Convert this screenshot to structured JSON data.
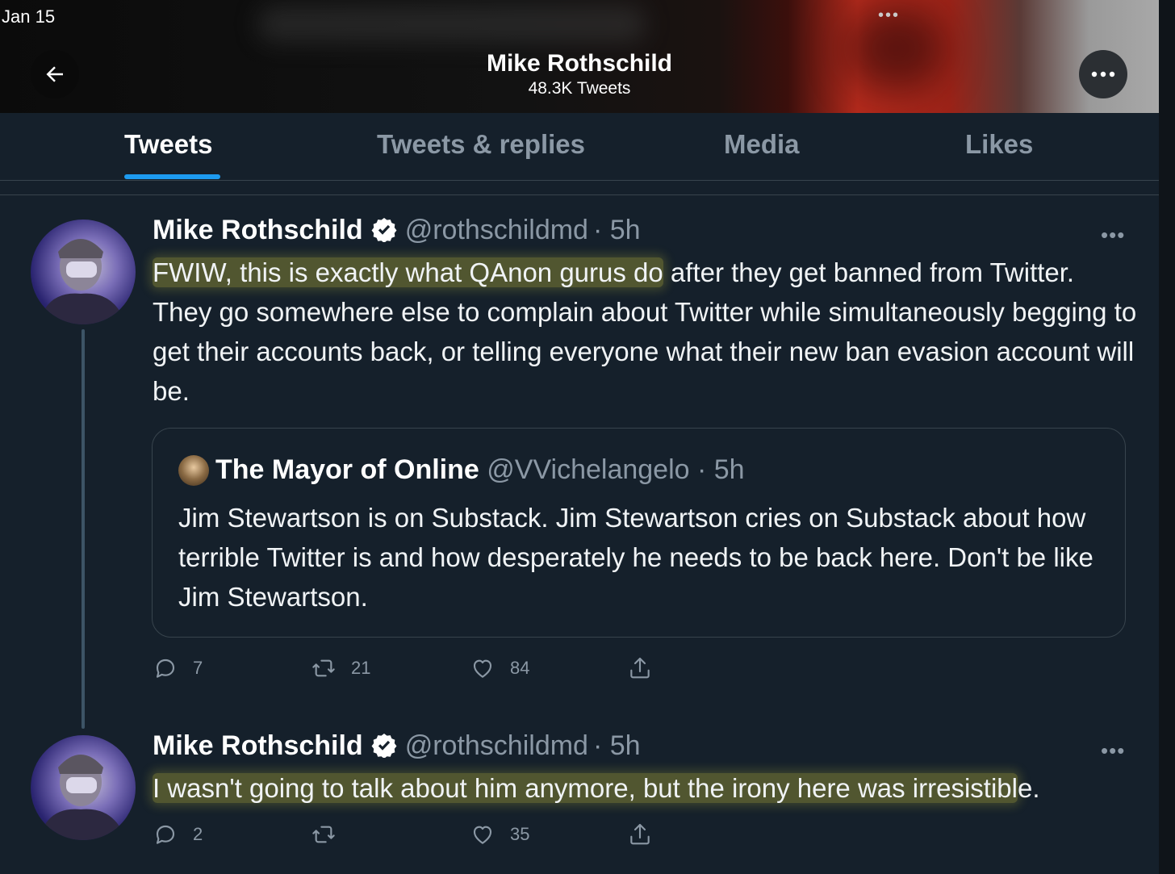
{
  "status": {
    "date": "Jan 15",
    "dots": "•••"
  },
  "header": {
    "name": "Mike Rothschild",
    "tweet_count": "48.3K Tweets"
  },
  "tabs": [
    {
      "label": "Tweets",
      "active": true
    },
    {
      "label": "Tweets & replies",
      "active": false
    },
    {
      "label": "Media",
      "active": false
    },
    {
      "label": "Likes",
      "active": false
    }
  ],
  "tweets": [
    {
      "name": "Mike Rothschild",
      "handle": "@rothschildmd",
      "time": "· 5h",
      "more": "•••",
      "text_highlight": "FWIW, this is exactly what QAnon gurus do",
      "text_rest": " after they get banned from Twitter. They go somewhere else to complain about Twitter while simultaneously begging to get their accounts back, or telling everyone what their new ban evasion account will be.",
      "quote": {
        "name": "The Mayor of Online",
        "handle": "@VVichelangelo",
        "time": "· 5h",
        "text": "Jim Stewartson is on Substack. Jim Stewartson cries on Substack about how terrible Twitter is and how desperately he needs to be back here. Don't be like Jim Stewartson."
      },
      "replies": "7",
      "retweets": "21",
      "likes": "84"
    },
    {
      "name": "Mike Rothschild",
      "handle": "@rothschildmd",
      "time": "· 5h",
      "more": "•••",
      "text_highlight": "I wasn't going to talk about him anymore, but the irony here was irresistibl",
      "text_rest": "e.",
      "replies": "2",
      "retweets": "",
      "likes": "35"
    }
  ],
  "colors": {
    "background": "#15202b",
    "accent": "#1d9bf0",
    "muted": "#8b98a5",
    "highlight": "#cfc93c"
  }
}
